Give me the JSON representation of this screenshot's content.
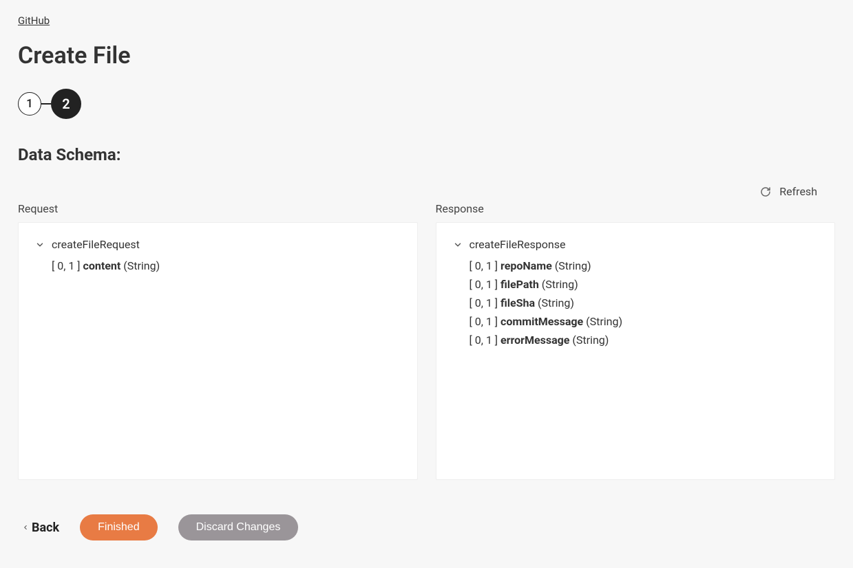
{
  "breadcrumb": {
    "link": "GitHub"
  },
  "title": "Create File",
  "stepper": {
    "step1": "1",
    "step2": "2"
  },
  "section": {
    "heading": "Data Schema:"
  },
  "refresh": {
    "label": "Refresh"
  },
  "request": {
    "label": "Request",
    "root": "createFileRequest",
    "fields": [
      {
        "card": "[ 0, 1 ]",
        "name": "content",
        "type": "(String)"
      }
    ]
  },
  "response": {
    "label": "Response",
    "root": "createFileResponse",
    "fields": [
      {
        "card": "[ 0, 1 ]",
        "name": "repoName",
        "type": "(String)"
      },
      {
        "card": "[ 0, 1 ]",
        "name": "filePath",
        "type": "(String)"
      },
      {
        "card": "[ 0, 1 ]",
        "name": "fileSha",
        "type": "(String)"
      },
      {
        "card": "[ 0, 1 ]",
        "name": "commitMessage",
        "type": "(String)"
      },
      {
        "card": "[ 0, 1 ]",
        "name": "errorMessage",
        "type": "(String)"
      }
    ]
  },
  "buttons": {
    "back": "Back",
    "finished": "Finished",
    "discard": "Discard Changes"
  }
}
